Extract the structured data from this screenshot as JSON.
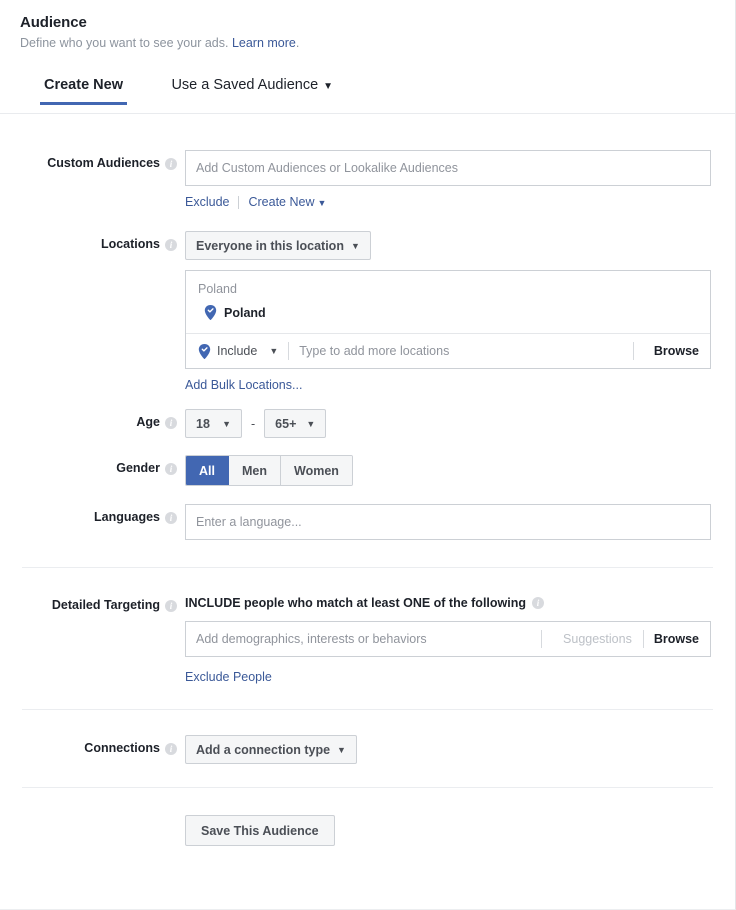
{
  "header": {
    "title": "Audience",
    "subtitle_prefix": "Define who you want to see your ads.",
    "learn_more": "Learn more",
    "subtitle_suffix": "."
  },
  "tabs": [
    {
      "label": "Create New",
      "active": true
    },
    {
      "label": "Use a Saved Audience",
      "active": false,
      "caret": "▼"
    }
  ],
  "custom_audiences": {
    "label": "Custom Audiences",
    "placeholder": "Add Custom Audiences or Lookalike Audiences",
    "value": "",
    "exclude_link": "Exclude",
    "create_new_link": "Create New",
    "caret": "▼"
  },
  "locations": {
    "label": "Locations",
    "scope_button": "Everyone in this location",
    "caret": "▼",
    "panel_header": "Poland",
    "selected": [
      {
        "name": "Poland",
        "icon": "location-pin-check-icon"
      }
    ],
    "include_label": "Include",
    "input_placeholder": "Type to add more locations",
    "input_value": "",
    "browse_label": "Browse",
    "bulk_link": "Add Bulk Locations..."
  },
  "age": {
    "label": "Age",
    "min": "18",
    "max": "65+",
    "separator": "-",
    "caret": "▼"
  },
  "gender": {
    "label": "Gender",
    "options": [
      {
        "label": "All",
        "selected": true
      },
      {
        "label": "Men",
        "selected": false
      },
      {
        "label": "Women",
        "selected": false
      }
    ]
  },
  "languages": {
    "label": "Languages",
    "placeholder": "Enter a language...",
    "value": ""
  },
  "detailed_targeting": {
    "label": "Detailed Targeting",
    "title": "INCLUDE people who match at least ONE of the following",
    "placeholder": "Add demographics, interests or behaviors",
    "value": "",
    "suggestions_label": "Suggestions",
    "browse_label": "Browse",
    "exclude_link": "Exclude People"
  },
  "connections": {
    "label": "Connections",
    "button": "Add a connection type",
    "caret": "▼"
  },
  "save": {
    "label": "Save This Audience"
  },
  "colors": {
    "accent": "#4267b2",
    "link": "#3b5998",
    "text": "#1d2129",
    "muted": "#90949c",
    "border": "#ccd0d5",
    "button_bg": "#f5f6f7"
  },
  "icons": {
    "info": "i",
    "location_pin_check": "location-pin-check-icon"
  }
}
